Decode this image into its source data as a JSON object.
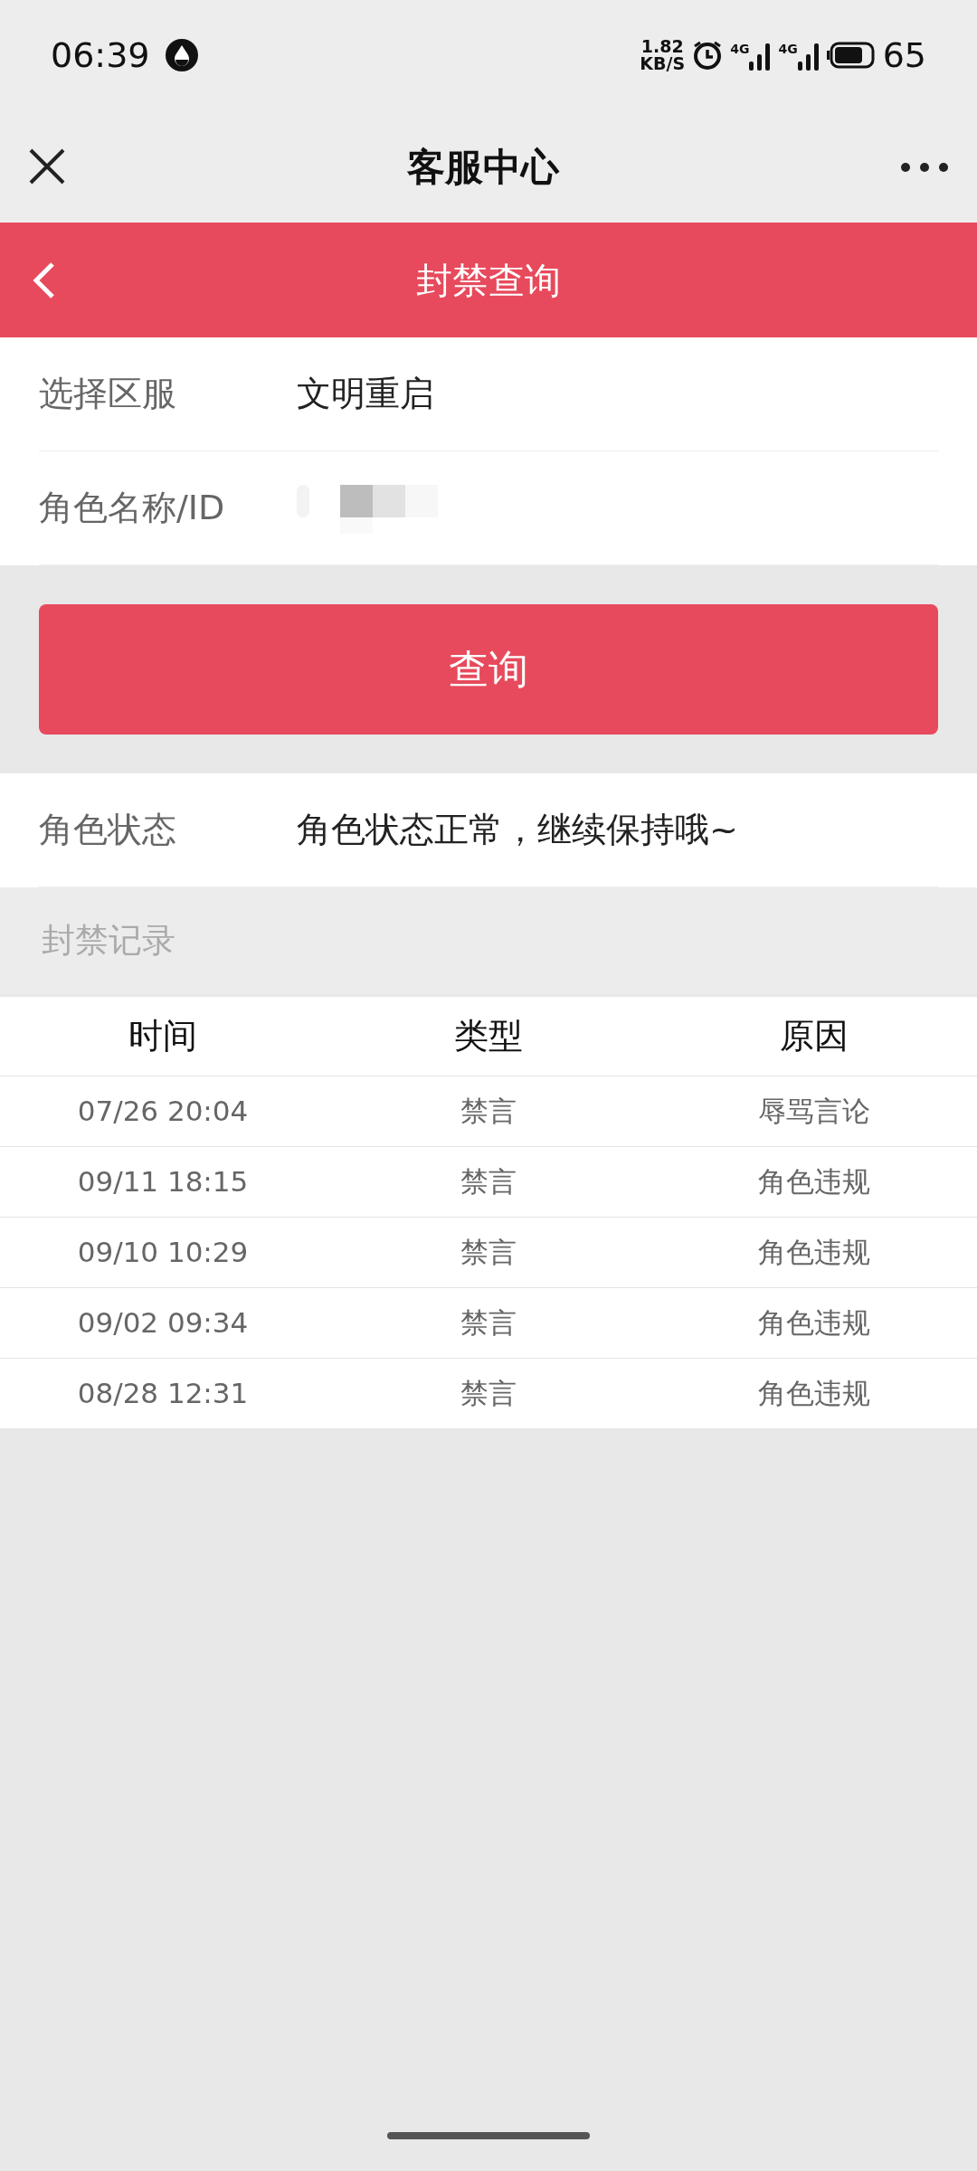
{
  "status_bar": {
    "time": "06:39",
    "speed_value": "1.82",
    "speed_unit": "KB/S",
    "network_1": "4G",
    "network_2": "4G",
    "battery": "65"
  },
  "title_bar": {
    "title": "客服中心"
  },
  "header": {
    "title": "封禁查询"
  },
  "form": [
    {
      "label": "选择区服",
      "value": "文明重启",
      "redacted": false
    },
    {
      "label": "角色名称/ID",
      "redacted": true
    }
  ],
  "query_button": "查询",
  "role_status": {
    "label": "角色状态",
    "value": "角色状态正常，继续保持哦~"
  },
  "records": {
    "title": "封禁记录",
    "columns": [
      "时间",
      "类型",
      "原因"
    ],
    "rows": [
      [
        "07/26 20:04",
        "禁言",
        "辱骂言论"
      ],
      [
        "09/11 18:15",
        "禁言",
        "角色违规"
      ],
      [
        "09/10 10:29",
        "禁言",
        "角色违规"
      ],
      [
        "09/02 09:34",
        "禁言",
        "角色违规"
      ],
      [
        "08/28 12:31",
        "禁言",
        "角色违规"
      ]
    ]
  }
}
